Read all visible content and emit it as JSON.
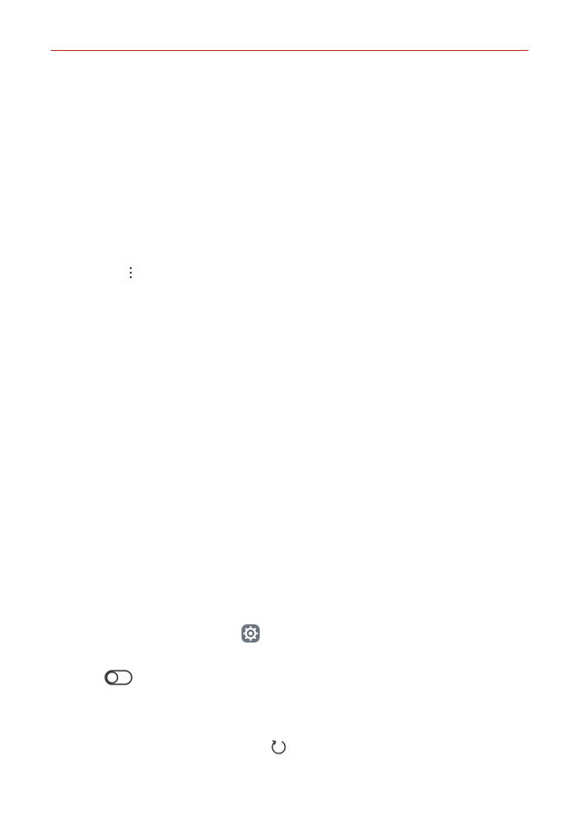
{
  "colors": {
    "accent_rule": "#c0392b",
    "icon_stroke": "#333333",
    "settings_fill": "#6d7480"
  },
  "icons": {
    "menu": "more-vertical-icon",
    "settings": "gear-icon",
    "toggle": "toggle-switch-icon",
    "refresh": "refresh-icon"
  }
}
